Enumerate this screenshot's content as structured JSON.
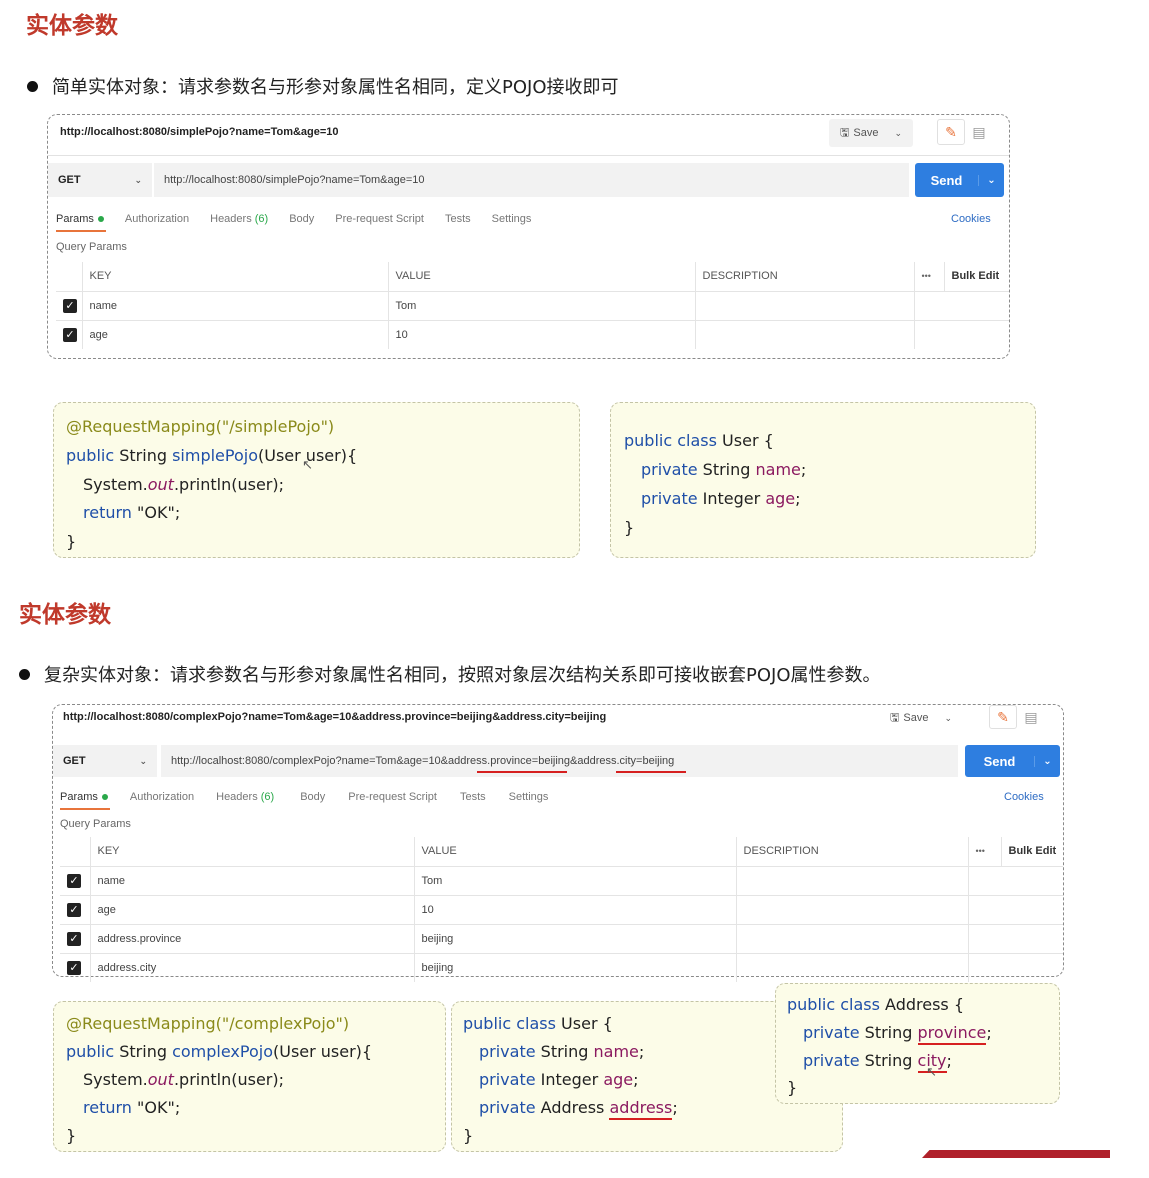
{
  "section1": {
    "title": "实体参数",
    "bullet": "简单实体对象：请求参数名与形参对象属性名相同，定义POJO接收即可"
  },
  "postman1": {
    "tab_url": "http://localhost:8080/simplePojo?name=Tom&age=10",
    "save_label": "Save",
    "method": "GET",
    "request_url": "http://localhost:8080/simplePojo?name=Tom&age=10",
    "send_label": "Send",
    "tabs": [
      "Params",
      "Authorization",
      "Headers",
      "(6)",
      "Body",
      "Pre-request Script",
      "Tests",
      "Settings"
    ],
    "cookies_label": "Cookies",
    "query_params_label": "Query Params",
    "columns": [
      "KEY",
      "VALUE",
      "DESCRIPTION",
      "•••",
      "Bulk Edit"
    ],
    "rows": [
      {
        "key": "name",
        "value": "Tom"
      },
      {
        "key": "age",
        "value": "10"
      }
    ]
  },
  "code1": {
    "annotation": "@RequestMapping(\"/simplePojo\")",
    "l2_kw": "public",
    "l2_type": "String",
    "l2_fn": "simplePojo",
    "l2_rest": "(User user){",
    "l3_pre": "System.",
    "l3_out": "out",
    "l3_post": ".println(user);",
    "l4_kw": "return",
    "l4_val": "\"OK\";",
    "l5": "}"
  },
  "class1": {
    "l1_kw": "public class",
    "l1_rest": "User {",
    "l2_kw": "private",
    "l2_type": "String",
    "l2_field": "name",
    "l3_kw": "private",
    "l3_type": "Integer",
    "l3_field": "age",
    "semi": ";",
    "close": "}"
  },
  "section2": {
    "title": "实体参数",
    "bullet": "复杂实体对象：请求参数名与形参对象属性名相同，按照对象层次结构关系即可接收嵌套POJO属性参数。"
  },
  "postman2": {
    "tab_url": "http://localhost:8080/complexPojo?name=Tom&age=10&address.province=beijing&address.city=beijing",
    "save_label": "Save",
    "method": "GET",
    "request_url": "http://localhost:8080/complexPojo?name=Tom&age=10&address.province=beijing&address.city=beijing",
    "send_label": "Send",
    "tabs": [
      "Params",
      "Authorization",
      "Headers",
      "(6)",
      "Body",
      "Pre-request Script",
      "Tests",
      "Settings"
    ],
    "cookies_label": "Cookies",
    "query_params_label": "Query Params",
    "columns": [
      "KEY",
      "VALUE",
      "DESCRIPTION",
      "•••",
      "Bulk Edit"
    ],
    "rows": [
      {
        "key": "name",
        "value": "Tom"
      },
      {
        "key": "age",
        "value": "10"
      },
      {
        "key": "address.province",
        "value": "beijing"
      },
      {
        "key": "address.city",
        "value": "beijing"
      }
    ]
  },
  "code2": {
    "annotation": "@RequestMapping(\"/complexPojo\")",
    "l2_kw": "public",
    "l2_type": "String",
    "l2_fn": "complexPojo",
    "l2_rest": "(User user){",
    "l3_pre": "System.",
    "l3_out": "out",
    "l3_post": ".println(user);",
    "l4_kw": "return",
    "l4_val": "\"OK\";",
    "l5": "}"
  },
  "class2": {
    "l1_kw": "public class",
    "l1_rest": "User {",
    "l2_kw": "private",
    "l2_type": "String",
    "l2_field": "name",
    "l3_kw": "private",
    "l3_type": "Integer",
    "l3_field": "age",
    "l4_kw": "private",
    "l4_type": "Address",
    "l4_field": "address",
    "semi": ";",
    "close": "}"
  },
  "class3": {
    "l1_kw": "public class",
    "l1_rest": "Address {",
    "l2_kw": "private",
    "l2_type": "String",
    "l2_field": "province",
    "l3_kw": "private",
    "l3_type": "String",
    "l3_field": "city",
    "semi": ";",
    "close": "}"
  },
  "colors": {
    "title_red": "#c0392b",
    "send_blue": "#2e7ee0",
    "code_bg": "#fcfce8",
    "keyword_blue": "#1f4fa8",
    "field_purple": "#8b1a60",
    "underline_red": "#d62020"
  }
}
